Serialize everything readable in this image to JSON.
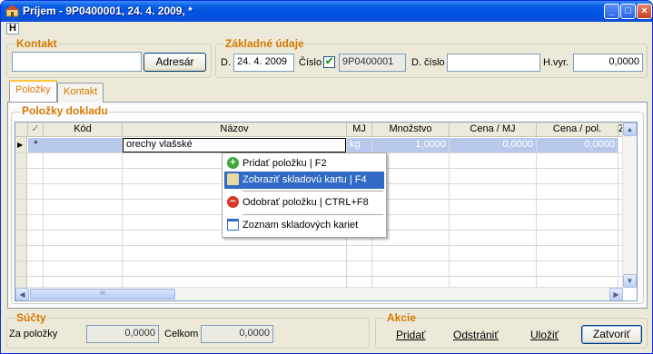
{
  "window": {
    "title": "Príjem - 9P0400001, 24. 4. 2009,  *",
    "h_button": "H"
  },
  "kontakt": {
    "title": "Kontakt",
    "address_value": "",
    "adresar_label": "Adresár"
  },
  "zakladne": {
    "title": "Základné údaje",
    "d_label": "D.",
    "date_value": "24. 4. 2009",
    "cislo_label": "Číslo",
    "cislo_checked": true,
    "cislo_value": "9P0400001",
    "dcislo_label": "D. číslo",
    "dcislo_value": "",
    "hvyr_label": "H.vyr.",
    "hvyr_value": "0,0000"
  },
  "tabs": [
    {
      "label": "Položky",
      "active": true
    },
    {
      "label": "Kontakt",
      "active": false
    }
  ],
  "polozky": {
    "title": "Položky dokladu",
    "columns": [
      "✓",
      "Kód",
      "Názov",
      "MJ",
      "Množstvo",
      "Cena / MJ",
      "Cena / pol.",
      "Z"
    ],
    "row": {
      "marker": "▶",
      "flag": "*",
      "kod": "",
      "nazov": "orechy vlašské",
      "mj": "kg",
      "mnozstvo": "1,0000",
      "cena_mj": "0,0000",
      "cena_pol": "0,0000"
    },
    "hscroll_thumb": "III"
  },
  "context_menu": {
    "items": [
      {
        "label": "Pridať položku | F2",
        "icon": "add-green-icon"
      },
      {
        "label": "Zobraziť skladovú kartu | F4",
        "icon": "card-pencil-icon",
        "highlighted": true
      },
      {
        "label": "Odobrať položku | CTRL+F8",
        "icon": "remove-red-icon"
      },
      {
        "label": "Zoznam skladových kariet",
        "icon": "window-list-icon"
      }
    ]
  },
  "sucty": {
    "title": "Súčty",
    "za_polozky_label": "Za položky",
    "za_polozky_value": "0,0000",
    "celkom_label": "Celkom",
    "celkom_value": "0,0000"
  },
  "akcie": {
    "title": "Akcie",
    "pridat": "Pridať",
    "odstranit": "Odstrániť",
    "ulozit": "Uložiť",
    "zatvorit": "Zatvoriť"
  },
  "colors": {
    "title_bar": "#0054e3",
    "group_title": "#d77800",
    "selection": "#b9c9ec",
    "menu_highlight": "#316ac5"
  }
}
